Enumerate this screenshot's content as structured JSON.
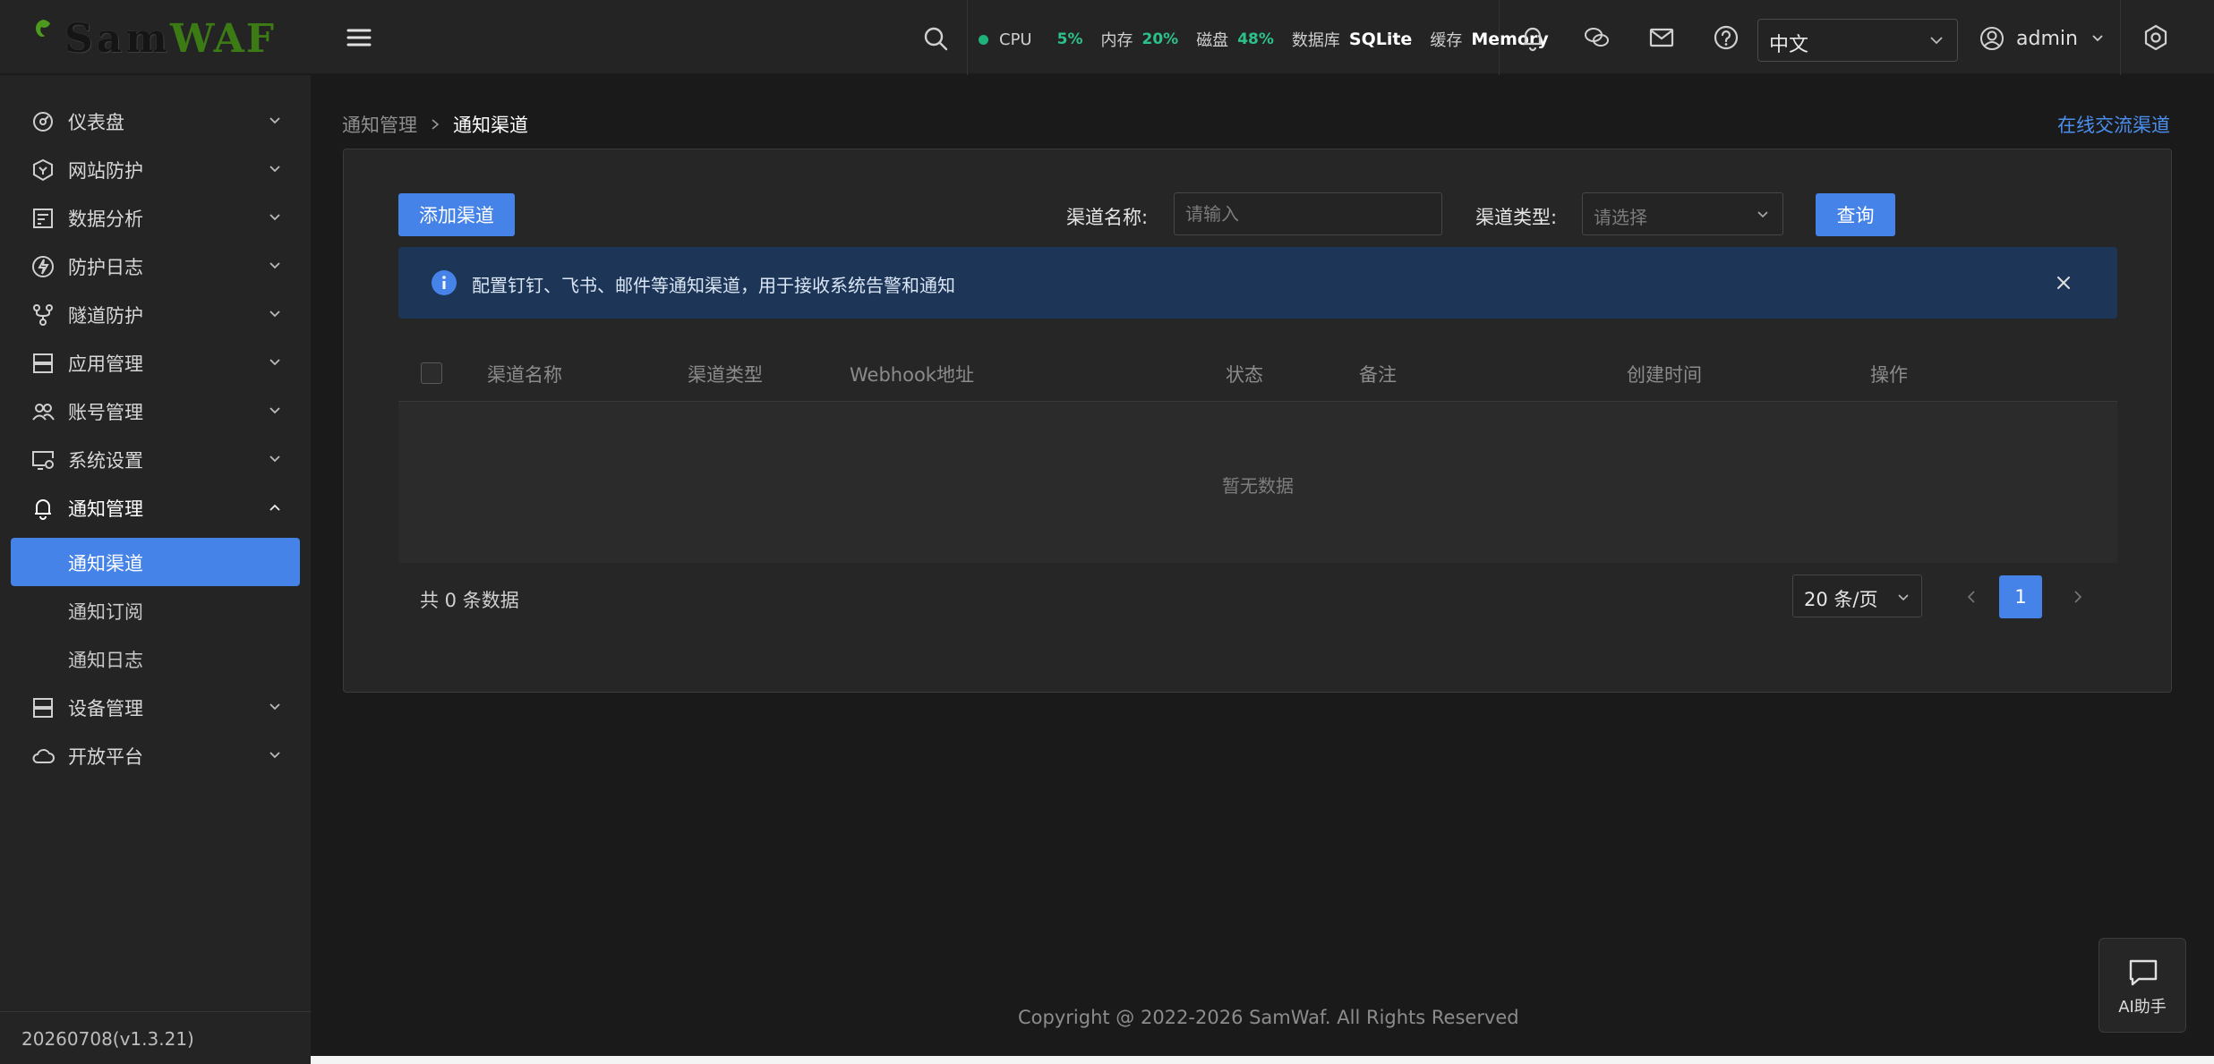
{
  "header": {
    "logo_sam": "Sam",
    "logo_waf": "WAF",
    "stats": {
      "cpu_label": "CPU",
      "cpu_value": "5%",
      "mem_label": "内存",
      "mem_value": "20%",
      "disk_label": "磁盘",
      "disk_value": "48%",
      "db_label": "数据库",
      "db_value": "SQLite",
      "cache_label": "缓存",
      "cache_value": "Memory"
    },
    "language": "中文",
    "user": "admin",
    "icons": [
      "search-icon",
      "bell-icon",
      "wechat-icon",
      "mail-icon",
      "help-icon",
      "settings-icon"
    ]
  },
  "sidebar": {
    "items": [
      {
        "label": "仪表盘",
        "icon": "dashboard-icon"
      },
      {
        "label": "网站防护",
        "icon": "shield-icon"
      },
      {
        "label": "数据分析",
        "icon": "chart-icon"
      },
      {
        "label": "防护日志",
        "icon": "lightning-icon"
      },
      {
        "label": "隧道防护",
        "icon": "tunnel-icon"
      },
      {
        "label": "应用管理",
        "icon": "server-icon"
      },
      {
        "label": "账号管理",
        "icon": "users-icon"
      },
      {
        "label": "系统设置",
        "icon": "monitor-gear-icon"
      },
      {
        "label": "通知管理",
        "icon": "bell-icon"
      },
      {
        "label": "设备管理",
        "icon": "server-icon"
      },
      {
        "label": "开放平台",
        "icon": "cloud-icon"
      }
    ],
    "sub_items": [
      {
        "label": "通知渠道"
      },
      {
        "label": "通知订阅"
      },
      {
        "label": "通知日志"
      }
    ],
    "version": "20260708(v1.3.21)"
  },
  "main": {
    "breadcrumb": {
      "parent": "通知管理",
      "current": "通知渠道"
    },
    "online_link": "在线交流渠道",
    "toolbar": {
      "add_label": "添加渠道",
      "name_label": "渠道名称:",
      "name_placeholder": "请输入",
      "type_label": "渠道类型:",
      "type_placeholder": "请选择",
      "query_label": "查询"
    },
    "alert": "配置钉钉、飞书、邮件等通知渠道，用于接收系统告警和通知",
    "table": {
      "columns": [
        "渠道名称",
        "渠道类型",
        "Webhook地址",
        "状态",
        "备注",
        "创建时间",
        "操作"
      ],
      "empty_text": "暂无数据"
    },
    "pagination": {
      "total": "共 0 条数据",
      "page_size": "20 条/页",
      "current_page": "1"
    }
  },
  "footer": "Copyright @ 2022-2026 SamWaf. All Rights Reserved",
  "ai_assistant": "AI助手",
  "colors": {
    "accent": "#4583e8",
    "success": "#2cc18a",
    "brand_green": "#3c7a16",
    "alert_bg": "#1d3658"
  }
}
